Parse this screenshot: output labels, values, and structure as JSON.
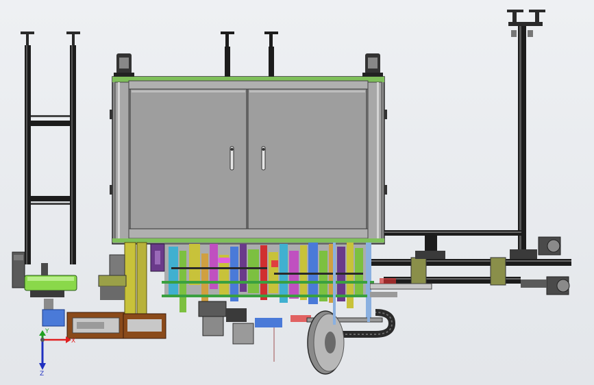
{
  "viewport": {
    "background_top": "#eef0f3",
    "background_bottom": "#e3e6ea"
  },
  "triad": {
    "x_label": "X",
    "y_label": "Y",
    "z_label": "Z",
    "x_color": "#e02020",
    "y_color": "#20a020",
    "z_color": "#2030c0"
  },
  "colors": {
    "frame_dark": "#1e1e1e",
    "frame_gray": "#8a8a8a",
    "panel": "#9a9a9a",
    "panel_dark": "#6e6e6e",
    "yellow": "#c8c23a",
    "olive": "#9aa048",
    "brown": "#8a4a1a",
    "green": "#7cc040",
    "magenta": "#c050c0",
    "purple": "#6a3a8a",
    "blue": "#4a7ad8",
    "cyan": "#40b0d0",
    "red": "#d03030",
    "light_gray": "#c8c8c8"
  }
}
